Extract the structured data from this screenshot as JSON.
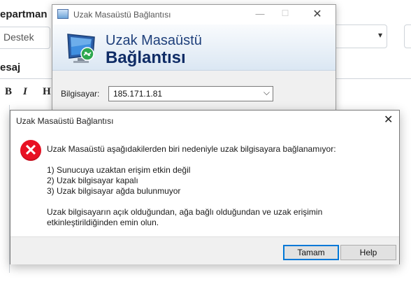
{
  "background_form": {
    "department_label": "epartman",
    "department_value": "Destek",
    "message_label": "esaj",
    "toolbar": {
      "bold": "B",
      "italic": "I",
      "heading": "H"
    }
  },
  "rdp_window": {
    "titlebar_text": "Uzak Masaüstü Bağlantısı",
    "banner_line1": "Uzak Masaüstü",
    "banner_line2": "Bağlantısı",
    "computer_label": "Bilgisayar:",
    "computer_value": "185.171.1.81"
  },
  "error_dialog": {
    "title": "Uzak Masaüstü Bağlantısı",
    "message": "Uzak Masaüstü aşağıdakilerden biri nedeniyle uzak bilgisayara bağlanamıyor:",
    "reasons": [
      "1) Sunucuya uzaktan erişim etkin değil",
      "2) Uzak bilgisayar kapalı",
      "3) Uzak bilgisayar ağda bulunmuyor"
    ],
    "note_line1": "Uzak bilgisayarın açık olduğundan, ağa bağlı olduğundan ve uzak erişimin",
    "note_line2": "etkinleştirildiğinden emin olun.",
    "ok_button": "Tamam",
    "help_button": "Help"
  },
  "colors": {
    "error_red": "#e81123",
    "focus_blue": "#0078d7",
    "banner_title": "#1e3f7a"
  }
}
